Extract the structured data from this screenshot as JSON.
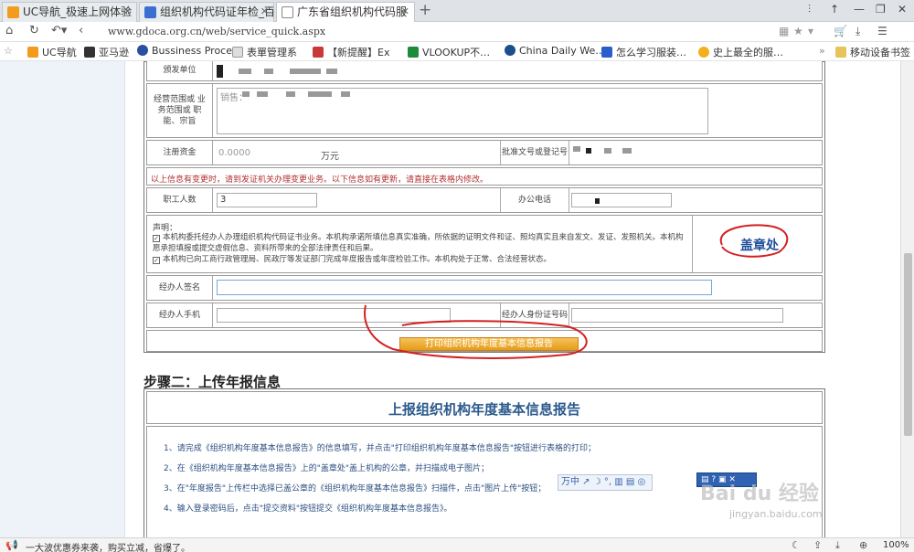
{
  "browser": {
    "tabs": [
      {
        "title": "UC导航_极速上网体验",
        "favicon_color": "#f29b1d"
      },
      {
        "title": "组织机构代码证年检_百",
        "favicon_color": "#3b6fd1"
      },
      {
        "title": "广东省组织机构代码服",
        "favicon_color": "#888888"
      }
    ],
    "new_tab": "+",
    "url": "www.gdoca.org.cn/web/service_quick.aspx",
    "bookmarks": [
      {
        "label": "UC导航",
        "color": "#f29b1d"
      },
      {
        "label": "亚马逊",
        "color": "#333333"
      },
      {
        "label": "Bussiness Proce",
        "color": "#2a4ea0"
      },
      {
        "label": "表單管理系",
        "color": "#666666"
      },
      {
        "label": "【新提醒】Ex",
        "color": "#c83a3a"
      },
      {
        "label": "VLOOKUP不…",
        "color": "#1e8a3c"
      },
      {
        "label": "China Daily We…",
        "color": "#1a4f8a"
      },
      {
        "label": "怎么学习服装…",
        "color": "#2a5ecb"
      },
      {
        "label": "史上最全的服…",
        "color": "#f2b01d"
      },
      {
        "label": "移动设备书签",
        "color": "#555555"
      }
    ],
    "more": "»"
  },
  "form": {
    "issuer_label": "颁发单位",
    "scope_label": "经营范围或 业务范围或 职能、宗旨",
    "scope_value": "销售：",
    "capital_label": "注册资金",
    "capital_value": "0.0000",
    "capital_unit": "万元",
    "approval_label": "批准文号或登记号",
    "notice": "以上信息有变更时，请到发证机关办理变更业务。以下信息如有更新，请直接在表格内修改。",
    "employees_label": "职工人数",
    "employees_value": "3",
    "phone_label": "办公电话",
    "declaration_title": "声明：",
    "declaration_1": "本机构委托经办人办理组织机构代码证书业务。本机构承诺所填信息真实准确，所依据的证明文件和证、照均真实且来自发文、发证、发照机关。本机构愿承担填报或提交虚假信息、资料所带来的全部法律责任和后果。",
    "declaration_2": "本机构已向工商行政管理局、民政厅等发证部门完成年度报告或年度检验工作。本机构处于正常、合法经营状态。",
    "seal_label": "盖章处",
    "agent_sign_label": "经办人签名",
    "agent_phone_label": "经办人手机",
    "agent_id_label": "经办人身份证号码",
    "print_button": "打印组织机构年度基本信息报告"
  },
  "step2": {
    "title": "步骤二：上传年报信息",
    "report_title": "上报组织机构年度基本信息报告",
    "instructions": [
      "1、请完成《组织机构年度基本信息报告》的信息填写，并点击\"打印组织机构年度基本信息报告\"按钮进行表格的打印；",
      "2、在《组织机构年度基本信息报告》上的\"盖章处\"盖上机构的公章，并扫描成电子图片；",
      "3、在\"年度报告\"上传栏中选择已盖公章的《组织机构年度基本信息报告》扫描件，点击\"图片上传\"按钮；",
      "4、输入登录密码后，点击\"提交资料\"按钮提交《组织机构年度基本信息报告》。"
    ]
  },
  "overlay": {
    "ime": "万中 ↗ ☽ °, ▥ ▤ ◎",
    "watermark": "Bai du 经验",
    "watermark_sub": "jingyan.baidu.com"
  },
  "statusbar": {
    "message": "一大波优惠券来袭，购买立减，省爆了。",
    "zoom": "100%"
  },
  "colors": {
    "annotation_red": "#d42020",
    "seal_blue": "#1f4e9c",
    "button_orange": "#e59c1a",
    "notice_red": "#b23030"
  }
}
